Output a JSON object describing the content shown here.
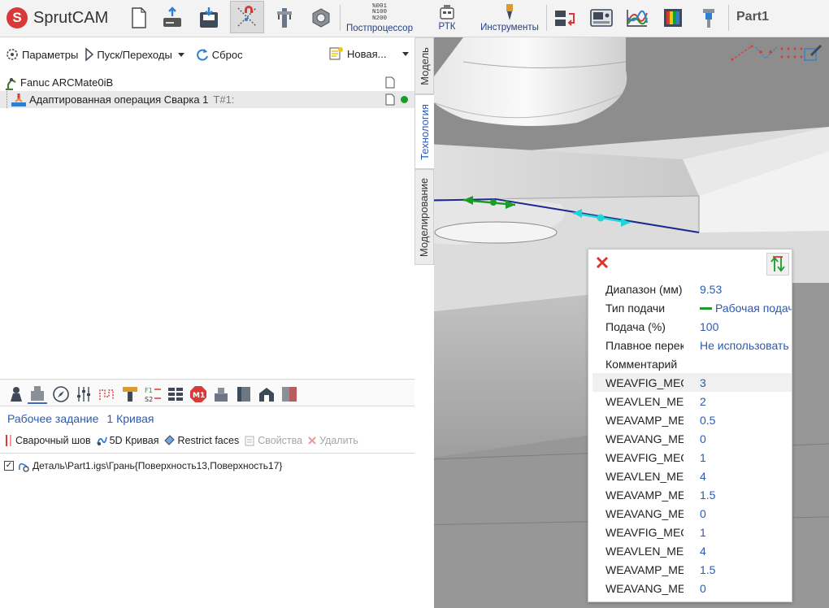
{
  "app": {
    "name": "SprutCAM",
    "project_title": "Part1"
  },
  "toolbar": {
    "nc_text": [
      "%001",
      "N100",
      "N200"
    ],
    "postprocessor_label": "Постпроцессор",
    "rtk_label": "РТК",
    "tools_label": "Инструменты"
  },
  "left_panel": {
    "toolbar": {
      "params_label": "Параметры",
      "start_label": "Пуск/Переходы",
      "reset_label": "Сброс",
      "new_label": "Новая..."
    },
    "tree": [
      {
        "label": "Fanuc ARCMate0iB",
        "suffix": ""
      },
      {
        "label": "Адаптированная операция Сварка 1",
        "suffix": "T#1:"
      }
    ],
    "job": {
      "title": "Рабочее задание",
      "count": "1 Кривая",
      "actions": {
        "weld_seam": "Сварочный шов",
        "curve_5d": "5D Кривая",
        "restrict_faces": "Restrict faces",
        "properties": "Свойства",
        "delete": "Удалить"
      },
      "geometry_item": "Деталь\\Part1.igs\\Грань{Поверхность13,Поверхность17}"
    }
  },
  "vertical_tabs": {
    "model": "Модель",
    "technology": "Технология",
    "modeling": "Моделирование"
  },
  "popup": {
    "rows": [
      {
        "name": "Диапазон (мм)",
        "value": "9.53"
      },
      {
        "name": "Тип подачи",
        "value": "Рабочая подача"
      },
      {
        "name": "Подача (%)",
        "value": "100"
      },
      {
        "name": "Плавное переключение",
        "value": "Не использовать"
      },
      {
        "name": "Комментарий",
        "value": ""
      },
      {
        "name": "WEAVFIG_MECH",
        "value": "3"
      },
      {
        "name": "WEAVLEN_MECH",
        "value": "2"
      },
      {
        "name": "WEAVAMP_MECH",
        "value": "0.5"
      },
      {
        "name": "WEAVANG_MECH",
        "value": "0"
      },
      {
        "name": "WEAVFIG_MECH",
        "value": "1"
      },
      {
        "name": "WEAVLEN_MECH",
        "value": "4"
      },
      {
        "name": "WEAVAMP_MECH",
        "value": "1.5"
      },
      {
        "name": "WEAVANG_MECH",
        "value": "0"
      },
      {
        "name": "WEAVFIG_MECH",
        "value": "1"
      },
      {
        "name": "WEAVLEN_MECH",
        "value": "4"
      },
      {
        "name": "WEAVAMP_MECH",
        "value": "1.5"
      },
      {
        "name": "WEAVANG_MECH",
        "value": "0"
      }
    ]
  },
  "colors": {
    "accent": "#2b5bb0",
    "active_dot": "#1a9c28",
    "close_red": "#e0342c",
    "feed_green": "#1a9c28",
    "toolpath_blue": "#1b2a8f",
    "cyan_marker": "#1fd6d6"
  }
}
